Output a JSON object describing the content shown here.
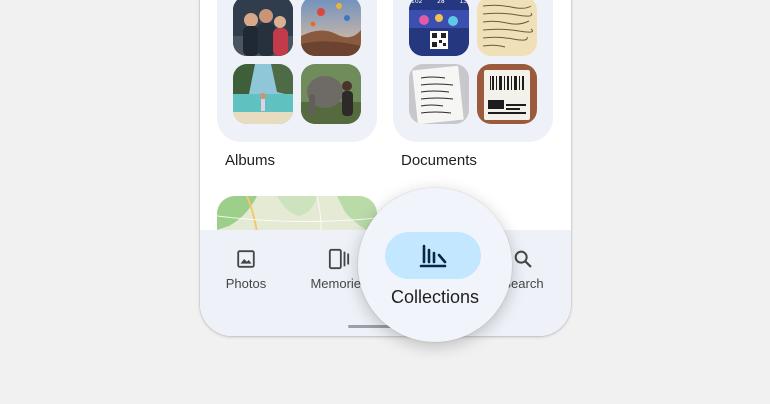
{
  "collections": {
    "albums_label": "Albums",
    "documents_label": "Documents"
  },
  "nav": {
    "items": [
      {
        "label": "Photos",
        "icon": "image-icon"
      },
      {
        "label": "Memories",
        "icon": "memories-icon"
      },
      {
        "label": "Collections",
        "icon": "collections-icon"
      },
      {
        "label": "Search",
        "icon": "search-icon"
      }
    ],
    "active": "Collections",
    "active_pill_color": "#c3e7ff"
  },
  "doc_thumbs": {
    "ticket_numbers": [
      "102",
      "28",
      "13"
    ]
  }
}
